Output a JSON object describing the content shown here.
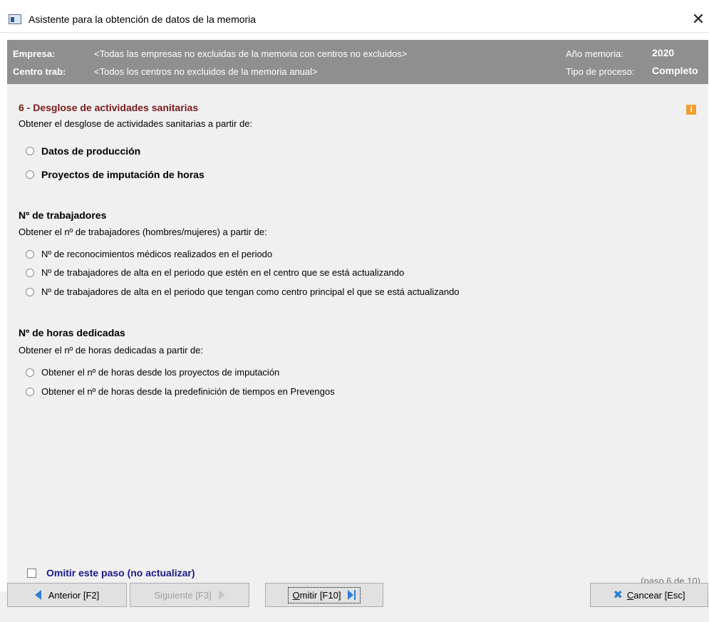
{
  "window": {
    "title": "Asistente para la obtención de datos de la memoria",
    "close_glyph": "✕"
  },
  "header": {
    "empresa_label": "Empresa:",
    "empresa_value": "<Todas las empresas no excluidas de la memoria con centros no excluidos>",
    "centro_label": "Centro trab:",
    "centro_value": "<Todos los centros no excluidos de la memoria anual>",
    "anio_label": "Año memoria:",
    "anio_value": "2020",
    "tipo_label": "Tipo de proceso:",
    "tipo_value": "Completo"
  },
  "section1": {
    "title": "6 - Desglose de actividades sanitarias",
    "description": "Obtener el desglose de actividades sanitarias a partir de:",
    "options": [
      "Datos de producción",
      "Proyectos de imputación de horas"
    ],
    "info_glyph": "i"
  },
  "section2": {
    "title": "Nº de trabajadores",
    "description": "Obtener el nº de trabajadores (hombres/mujeres) a partir de:",
    "options": [
      "Nº de reconocimientos médicos realizados en el periodo",
      "Nº de trabajadores de alta en el periodo que estén en el centro que se está actualizando",
      "Nº de trabajadores de alta en el periodo que tengan como centro principal el que se está actualizando"
    ]
  },
  "section3": {
    "title": "Nº de horas dedicadas",
    "description": "Obtener el nº de horas dedicadas a partir de:",
    "options": [
      "Obtener el nº de horas desde los proyectos de imputación",
      "Obtener el nº de horas desde la predefinición de tiempos en Prevengos"
    ]
  },
  "footer": {
    "omit_checkbox_label": "Omitir este paso (no actualizar)",
    "step_indicator": "(paso 6 de 10)"
  },
  "buttons": {
    "anterior": "Anterior [F2]",
    "siguiente": "Siguiente [F3]",
    "omitir_first": "O",
    "omitir_rest": "mitir [F10]",
    "cancelar_first": "C",
    "cancelar_rest": "ancear [Esc]"
  },
  "colors": {
    "header_band": "#8f8f8f",
    "section_title_red": "#7a1a1a",
    "omit_label": "#1a1a8a",
    "accent_blue": "#2b7fd6",
    "info_orange": "#f0a030"
  }
}
